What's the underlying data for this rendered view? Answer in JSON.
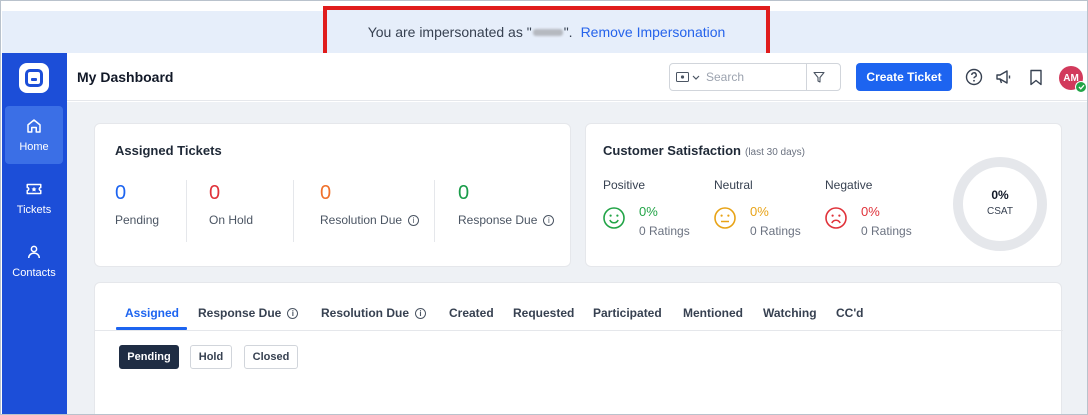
{
  "banner": {
    "prefix": "You are impersonated as \"",
    "suffix": "\".",
    "remove_label": "Remove Impersonation"
  },
  "sidebar": {
    "logo_icon": "app-logo-icon",
    "items": [
      {
        "label": "Home",
        "icon": "home-icon",
        "active": true
      },
      {
        "label": "Tickets",
        "icon": "ticket-icon",
        "active": false
      },
      {
        "label": "Contacts",
        "icon": "person-icon",
        "active": false
      }
    ]
  },
  "header": {
    "title": "My Dashboard",
    "search_placeholder": "Search",
    "create_label": "Create Ticket",
    "avatar_initials": "AM"
  },
  "assigned": {
    "title": "Assigned Tickets",
    "stats": [
      {
        "value": "0",
        "label": "Pending",
        "color": "#1d64f0",
        "info": false
      },
      {
        "value": "0",
        "label": "On Hold",
        "color": "#e0323a",
        "info": false
      },
      {
        "value": "0",
        "label": "Resolution Due",
        "color": "#f0712b",
        "info": true
      },
      {
        "value": "0",
        "label": "Response Due",
        "color": "#1a9c4a",
        "info": true
      }
    ]
  },
  "csat": {
    "title": "Customer Satisfaction",
    "subtitle": "(last 30 days)",
    "columns": [
      {
        "label": "Positive",
        "pct": "0%",
        "ratings": "0 Ratings",
        "color": "#22a447",
        "face": "smile-icon"
      },
      {
        "label": "Neutral",
        "pct": "0%",
        "ratings": "0 Ratings",
        "color": "#e8a317",
        "face": "neutral-face-icon"
      },
      {
        "label": "Negative",
        "pct": "0%",
        "ratings": "0 Ratings",
        "color": "#e0323a",
        "face": "frown-icon"
      }
    ],
    "gauge_value": "0%",
    "gauge_label": "CSAT"
  },
  "tabs": [
    {
      "label": "Assigned",
      "active": true,
      "info": false
    },
    {
      "label": "Response Due",
      "active": false,
      "info": true
    },
    {
      "label": "Resolution Due",
      "active": false,
      "info": true
    },
    {
      "label": "Created",
      "active": false,
      "info": false
    },
    {
      "label": "Requested",
      "active": false,
      "info": false
    },
    {
      "label": "Participated",
      "active": false,
      "info": false
    },
    {
      "label": "Mentioned",
      "active": false,
      "info": false
    },
    {
      "label": "Watching",
      "active": false,
      "info": false
    },
    {
      "label": "CC'd",
      "active": false,
      "info": false
    }
  ],
  "filters": [
    {
      "label": "Pending",
      "active": true
    },
    {
      "label": "Hold",
      "active": false
    },
    {
      "label": "Closed",
      "active": false
    }
  ]
}
